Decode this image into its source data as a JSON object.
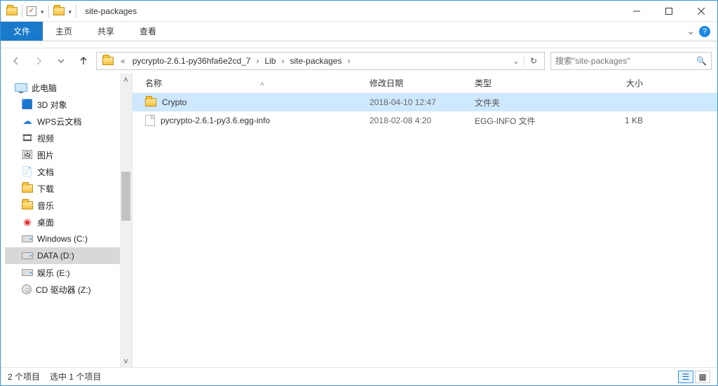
{
  "window": {
    "title": "site-packages"
  },
  "ribbon": {
    "tabs": [
      "文件",
      "主页",
      "共享",
      "查看"
    ]
  },
  "address": {
    "crumbs": [
      "pycrypto-2.6.1-py36hfa6e2cd_7",
      "Lib",
      "site-packages"
    ]
  },
  "search": {
    "placeholder": "搜索\"site-packages\""
  },
  "sidebar": {
    "items": [
      {
        "label": "此电脑"
      },
      {
        "label": "3D 对象"
      },
      {
        "label": "WPS云文档"
      },
      {
        "label": "视频"
      },
      {
        "label": "图片"
      },
      {
        "label": "文档"
      },
      {
        "label": "下载"
      },
      {
        "label": "音乐"
      },
      {
        "label": "桌面"
      },
      {
        "label": "Windows (C:)"
      },
      {
        "label": "DATA (D:)"
      },
      {
        "label": "娱乐 (E:)"
      },
      {
        "label": "CD 驱动器 (Z:)"
      }
    ],
    "selected_index": 10
  },
  "columns": [
    "名称",
    "修改日期",
    "类型",
    "大小"
  ],
  "files": [
    {
      "name": "Crypto",
      "date": "2018-04-10 12:47",
      "type": "文件夹",
      "size": "",
      "selected": true
    },
    {
      "name": "pycrypto-2.6.1-py3.6.egg-info",
      "date": "2018-02-08 4:20",
      "type": "EGG-INFO 文件",
      "size": "1 KB",
      "selected": false
    }
  ],
  "status": {
    "item_count": "2 个项目",
    "selected": "选中 1 个项目"
  },
  "colors": {
    "accent": "#1979ca",
    "selection": "#cde8ff",
    "border": "#3a96dd"
  }
}
